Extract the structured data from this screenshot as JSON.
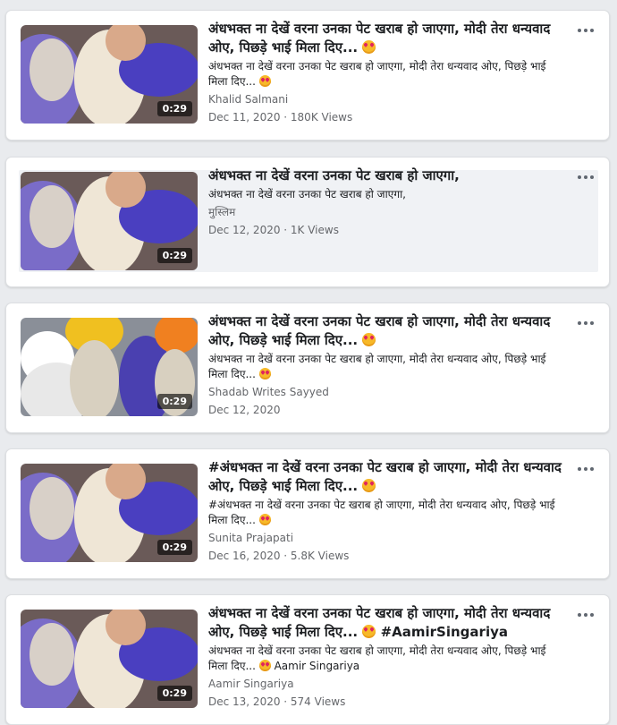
{
  "videos": [
    {
      "title": "अंधभक्त ना देखें वरना उनका पेट खराब हो जाएगा, मोदी तेरा धन्यवाद ओए, पिछड़े भाई मिला दिए...",
      "title_suffix": "",
      "description": "अंधभक्त ना देखें वरना उनका पेट खराब हो जाएगा, मोदी तेरा धन्यवाद ओए, पिछड़े भाई मिला दिए...",
      "desc_suffix": "",
      "author": "Khalid Salmani",
      "meta": "Dec 11, 2020 · 180K Views",
      "duration": "0:29",
      "has_title_emoji": true,
      "has_desc_emoji": true,
      "thumb_variant": "a"
    },
    {
      "title": "अंधभक्त ना देखें वरना उनका पेट खराब हो जाएगा,",
      "title_suffix": "",
      "description": "अंधभक्त ना देखें वरना उनका पेट खराब हो जाएगा,",
      "desc_suffix": "",
      "author": "मुस्लिम",
      "meta": "Dec 12, 2020 · 1K Views",
      "duration": "0:29",
      "has_title_emoji": false,
      "has_desc_emoji": false,
      "thumb_variant": "a"
    },
    {
      "title": "अंधभक्त ना देखें वरना उनका पेट खराब हो जाएगा, मोदी तेरा धन्यवाद ओए, पिछड़े भाई मिला दिए...",
      "title_suffix": "",
      "description": "अंधभक्त ना देखें वरना उनका पेट खराब हो जाएगा, मोदी तेरा धन्यवाद ओए, पिछड़े भाई मिला दिए...",
      "desc_suffix": "",
      "author": "Shadab Writes Sayyed",
      "meta": "Dec 12, 2020",
      "duration": "0:29",
      "has_title_emoji": true,
      "has_desc_emoji": true,
      "thumb_variant": "b"
    },
    {
      "title": "#अंधभक्त ना देखें वरना उनका पेट खराब हो जाएगा, मोदी तेरा धन्यवाद ओए, पिछड़े भाई मिला दिए...",
      "title_suffix": "",
      "description": "#अंधभक्त ना देखें वरना उनका पेट खराब हो जाएगा, मोदी तेरा धन्यवाद ओए, पिछड़े भाई मिला दिए...",
      "desc_suffix": "",
      "author": "Sunita Prajapati",
      "meta": "Dec 16, 2020 · 5.8K Views",
      "duration": "0:29",
      "has_title_emoji": true,
      "has_desc_emoji": true,
      "thumb_variant": "a"
    },
    {
      "title": "अंधभक्त ना देखें वरना उनका पेट खराब हो जाएगा, मोदी तेरा धन्यवाद ओए, पिछड़े भाई मिला दिए...",
      "title_suffix": "#AamirSingariya",
      "description": "अंधभक्त ना देखें वरना उनका पेट खराब हो जाएगा, मोदी तेरा धन्यवाद ओए, पिछड़े भाई मिला दिए...",
      "desc_suffix": "Aamir Singariya",
      "author": "Aamir Singariya",
      "meta": "Dec 13, 2020 · 574 Views",
      "duration": "0:29",
      "has_title_emoji": true,
      "has_desc_emoji": true,
      "thumb_variant": "a"
    }
  ],
  "colors": {
    "page_bg": "#e9ebee",
    "card_bg": "#ffffff",
    "text": "#1c1e21",
    "secondary": "#65676b",
    "highlight": "#f0f2f5"
  },
  "icons": {
    "more": "more-options-icon",
    "emoji": "heart-eyes-emoji-icon"
  }
}
